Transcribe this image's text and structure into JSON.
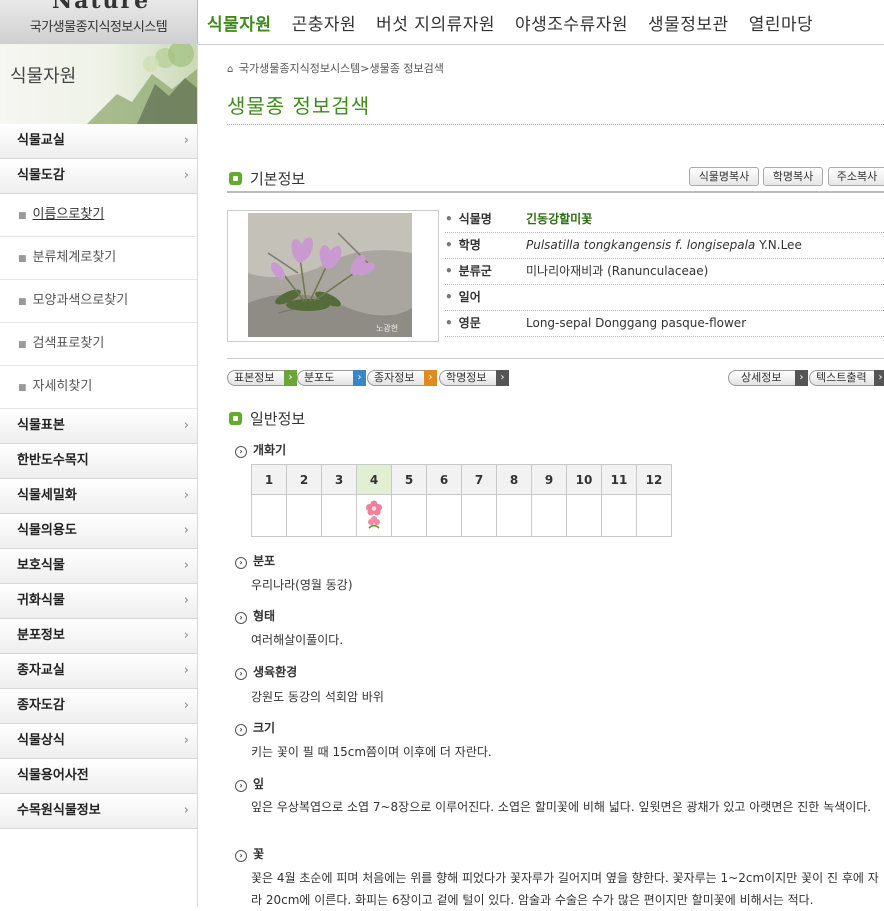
{
  "header": {
    "logo_text": "국가생물종지식정보시스템",
    "logo_mark": "Nature",
    "nav": [
      "식물자원",
      "곤충자원",
      "버섯 지의류자원",
      "야생조수류자원",
      "생물정보관",
      "열린마당"
    ]
  },
  "sidebar": {
    "title": "식물자원",
    "items": [
      {
        "label": "식물교실"
      },
      {
        "label": "식물도감"
      },
      {
        "label": "이름으로찾기"
      },
      {
        "label": "분류체계로찾기"
      },
      {
        "label": "모양과색으로찾기"
      },
      {
        "label": "검색표로찾기"
      },
      {
        "label": "자세히찾기"
      },
      {
        "label": "식물표본"
      },
      {
        "label": "한반도수목지"
      },
      {
        "label": "식물세밀화"
      },
      {
        "label": "식물의용도"
      },
      {
        "label": "보호식물"
      },
      {
        "label": "귀화식물"
      },
      {
        "label": "분포정보"
      },
      {
        "label": "종자교실"
      },
      {
        "label": "종자도감"
      },
      {
        "label": "식물상식"
      },
      {
        "label": "식물용어사전"
      },
      {
        "label": "수목원식물정보"
      }
    ]
  },
  "main": {
    "breadcrumb": "국가생물종지식정보시스템>생물종 정보검색",
    "page_title": "생물종 정보검색",
    "basic": {
      "title": "기본정보",
      "buttons": [
        "식물명복사",
        "학명복사",
        "주소복사"
      ],
      "photo_credit": "노광현",
      "fields": [
        {
          "key": "식물명",
          "value": "긴동강할미꽃"
        },
        {
          "key": "학명",
          "value_italic": "Pulsatilla tongkangensis f. longisepala",
          "value_author": " Y.N.Lee"
        },
        {
          "key": "분류군",
          "value": "미나리아재비과 (Ranunculaceae)"
        },
        {
          "key": "일어",
          "value": ""
        },
        {
          "key": "영문",
          "value": "Long-sepal Donggang pasque-flower"
        }
      ]
    },
    "tabs_left": [
      "표본정보",
      "분포도",
      "종자정보",
      "학명정보"
    ],
    "tabs_right": [
      "상세정보",
      "텍스트출력"
    ],
    "general": {
      "title": "일반정보",
      "flowering_label": "개화기",
      "months": [
        "1",
        "2",
        "3",
        "4",
        "5",
        "6",
        "7",
        "8",
        "9",
        "10",
        "11",
        "12"
      ],
      "flowering_months": [
        4
      ],
      "sections": [
        {
          "label": "분포",
          "text": "우리나라(영월 동강)"
        },
        {
          "label": "형태",
          "text": "여러해살이풀이다."
        },
        {
          "label": "생육환경",
          "text": "강원도 동강의 석회암 바위"
        },
        {
          "label": "크기",
          "text": "키는 꽃이 필 때 15cm쯤이며 이후에 더 자란다."
        },
        {
          "label": "잎",
          "text": "잎은 우상복엽으로 소엽 7~8장으로 이루어진다. 소엽은 할미꽃에 비해 넓다. 잎윗면은 광채가 있고 아랫면은 진한 녹색이다."
        },
        {
          "label": "꽃",
          "text": "꽃은 4월 초순에 피며 처음에는 위를 향해 피었다가 꽃자루가 길어지며 옆을 향한다. 꽃자루는 1~2cm이지만 꽃이 진 후에 자라 20cm에 이른다. 화피는 6장이고 겉에 털이 있다. 암술과 수술은 수가 많은 편이지만 할미꽃에 비해서는 적다."
        }
      ]
    }
  }
}
